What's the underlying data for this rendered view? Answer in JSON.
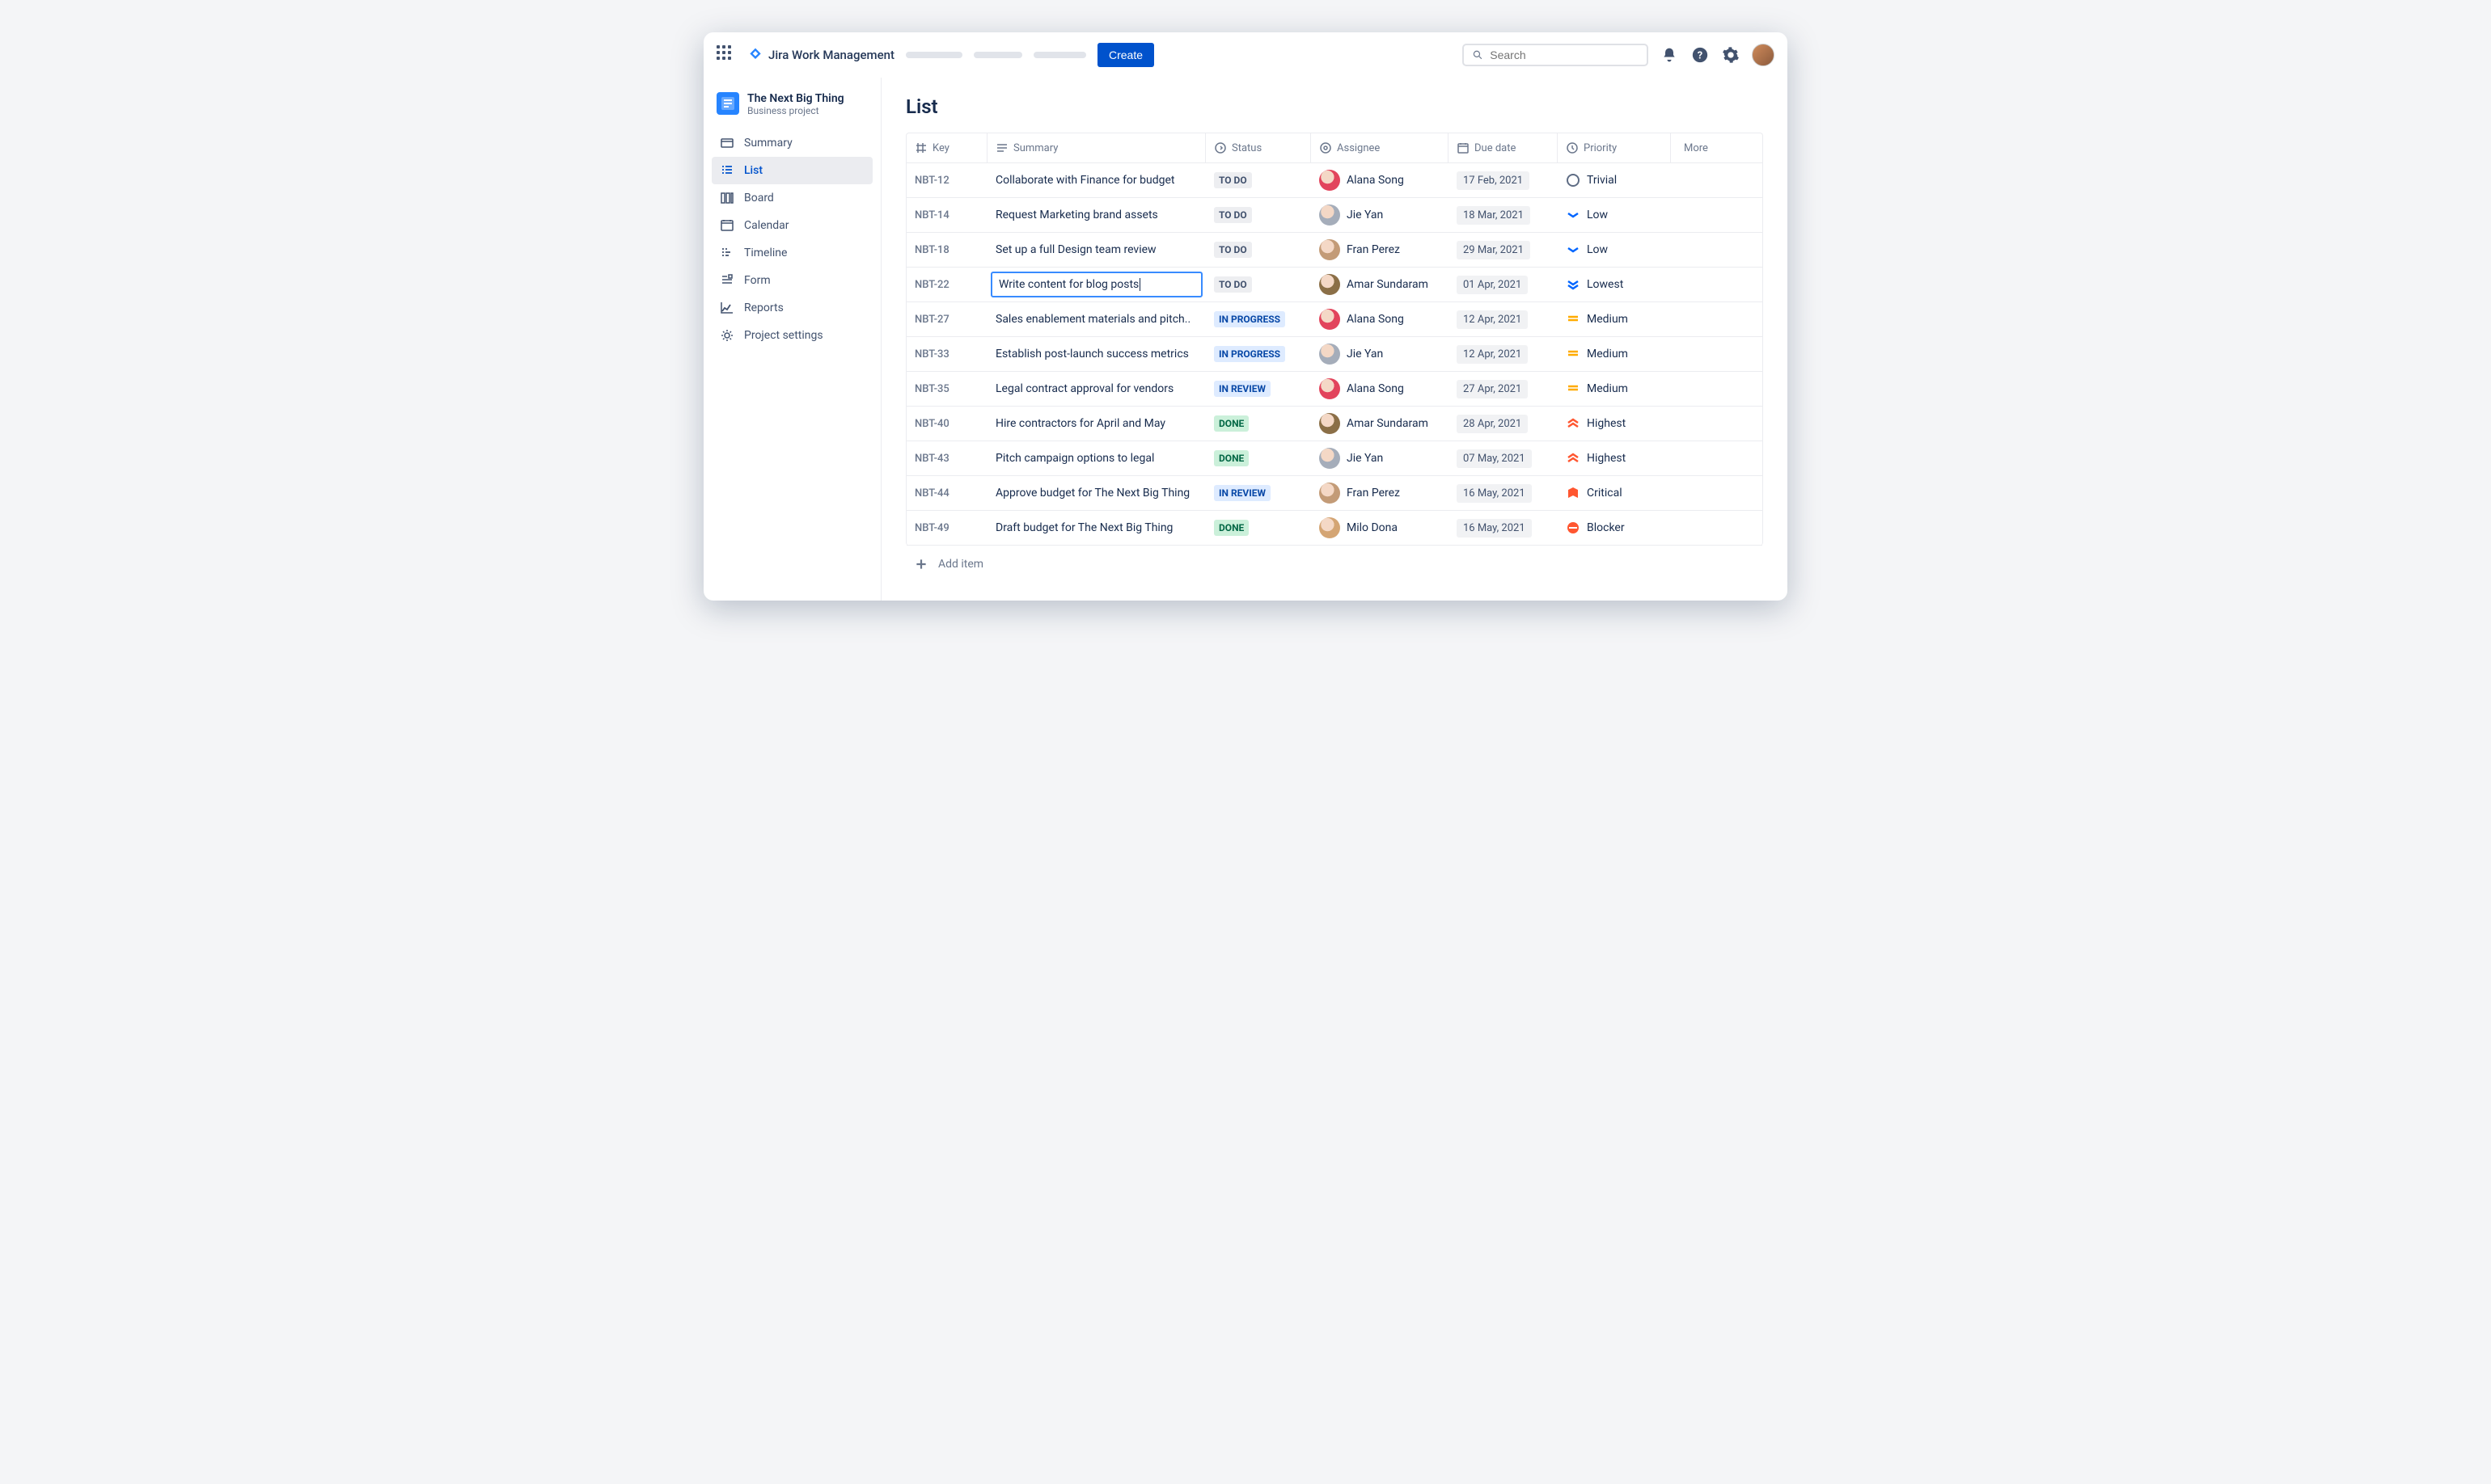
{
  "header": {
    "product": "Jira Work Management",
    "create_label": "Create",
    "search_placeholder": "Search"
  },
  "project": {
    "name": "The Next Big Thing",
    "type": "Business project"
  },
  "sidebar": {
    "items": [
      {
        "label": "Summary"
      },
      {
        "label": "List"
      },
      {
        "label": "Board"
      },
      {
        "label": "Calendar"
      },
      {
        "label": "Timeline"
      },
      {
        "label": "Form"
      },
      {
        "label": "Reports"
      },
      {
        "label": "Project settings"
      }
    ]
  },
  "page": {
    "title": "List"
  },
  "columns": {
    "key": "Key",
    "summary": "Summary",
    "status": "Status",
    "assignee": "Assignee",
    "due": "Due date",
    "priority": "Priority",
    "more": "More"
  },
  "rows": [
    {
      "key": "NBT-12",
      "summary": "Collaborate with Finance for budget",
      "status": "TO DO",
      "status_kind": "todo",
      "assignee": "Alana Song",
      "av": "#E2445C",
      "due": "17 Feb, 2021",
      "priority": "Trivial",
      "prio": "trivial"
    },
    {
      "key": "NBT-14",
      "summary": "Request Marketing brand assets",
      "status": "TO DO",
      "status_kind": "todo",
      "assignee": "Jie Yan",
      "av": "#A5ADBA",
      "due": "18 Mar, 2021",
      "priority": "Low",
      "prio": "low"
    },
    {
      "key": "NBT-18",
      "summary": "Set up a full Design team review",
      "status": "TO DO",
      "status_kind": "todo",
      "assignee": "Fran Perez",
      "av": "#C39B77",
      "due": "29 Mar, 2021",
      "priority": "Low",
      "prio": "low"
    },
    {
      "key": "NBT-22",
      "summary": "Write content for blog posts",
      "status": "TO DO",
      "status_kind": "todo",
      "assignee": "Amar Sundaram",
      "av": "#8B6F47",
      "due": "01 Apr, 2021",
      "priority": "Lowest",
      "prio": "lowest",
      "editing": true
    },
    {
      "key": "NBT-27",
      "summary": "Sales enablement materials and pitch..",
      "status": "IN PROGRESS",
      "status_kind": "inprogress",
      "assignee": "Alana Song",
      "av": "#E2445C",
      "due": "12 Apr, 2021",
      "priority": "Medium",
      "prio": "medium"
    },
    {
      "key": "NBT-33",
      "summary": "Establish post-launch success metrics",
      "status": "IN PROGRESS",
      "status_kind": "inprogress",
      "assignee": "Jie Yan",
      "av": "#A5ADBA",
      "due": "12 Apr, 2021",
      "priority": "Medium",
      "prio": "medium"
    },
    {
      "key": "NBT-35",
      "summary": "Legal contract approval for vendors",
      "status": "IN REVIEW",
      "status_kind": "inreview",
      "assignee": "Alana Song",
      "av": "#E2445C",
      "due": "27 Apr, 2021",
      "priority": "Medium",
      "prio": "medium"
    },
    {
      "key": "NBT-40",
      "summary": "Hire contractors for April and May",
      "status": "DONE",
      "status_kind": "done",
      "assignee": "Amar Sundaram",
      "av": "#8B6F47",
      "due": "28 Apr, 2021",
      "priority": "Highest",
      "prio": "highest"
    },
    {
      "key": "NBT-43",
      "summary": "Pitch campaign options to legal",
      "status": "DONE",
      "status_kind": "done",
      "assignee": "Jie Yan",
      "av": "#A5ADBA",
      "due": "07 May, 2021",
      "priority": "Highest",
      "prio": "highest"
    },
    {
      "key": "NBT-44",
      "summary": "Approve budget for The Next Big Thing",
      "status": "IN REVIEW",
      "status_kind": "inreview",
      "assignee": "Fran Perez",
      "av": "#C39B77",
      "due": "16 May, 2021",
      "priority": "Critical",
      "prio": "critical"
    },
    {
      "key": "NBT-49",
      "summary": "Draft budget for The Next Big Thing",
      "status": "DONE",
      "status_kind": "done",
      "assignee": "Milo Dona",
      "av": "#D4A574",
      "due": "16 May, 2021",
      "priority": "Blocker",
      "prio": "blocker"
    }
  ],
  "add_item_label": "Add item"
}
